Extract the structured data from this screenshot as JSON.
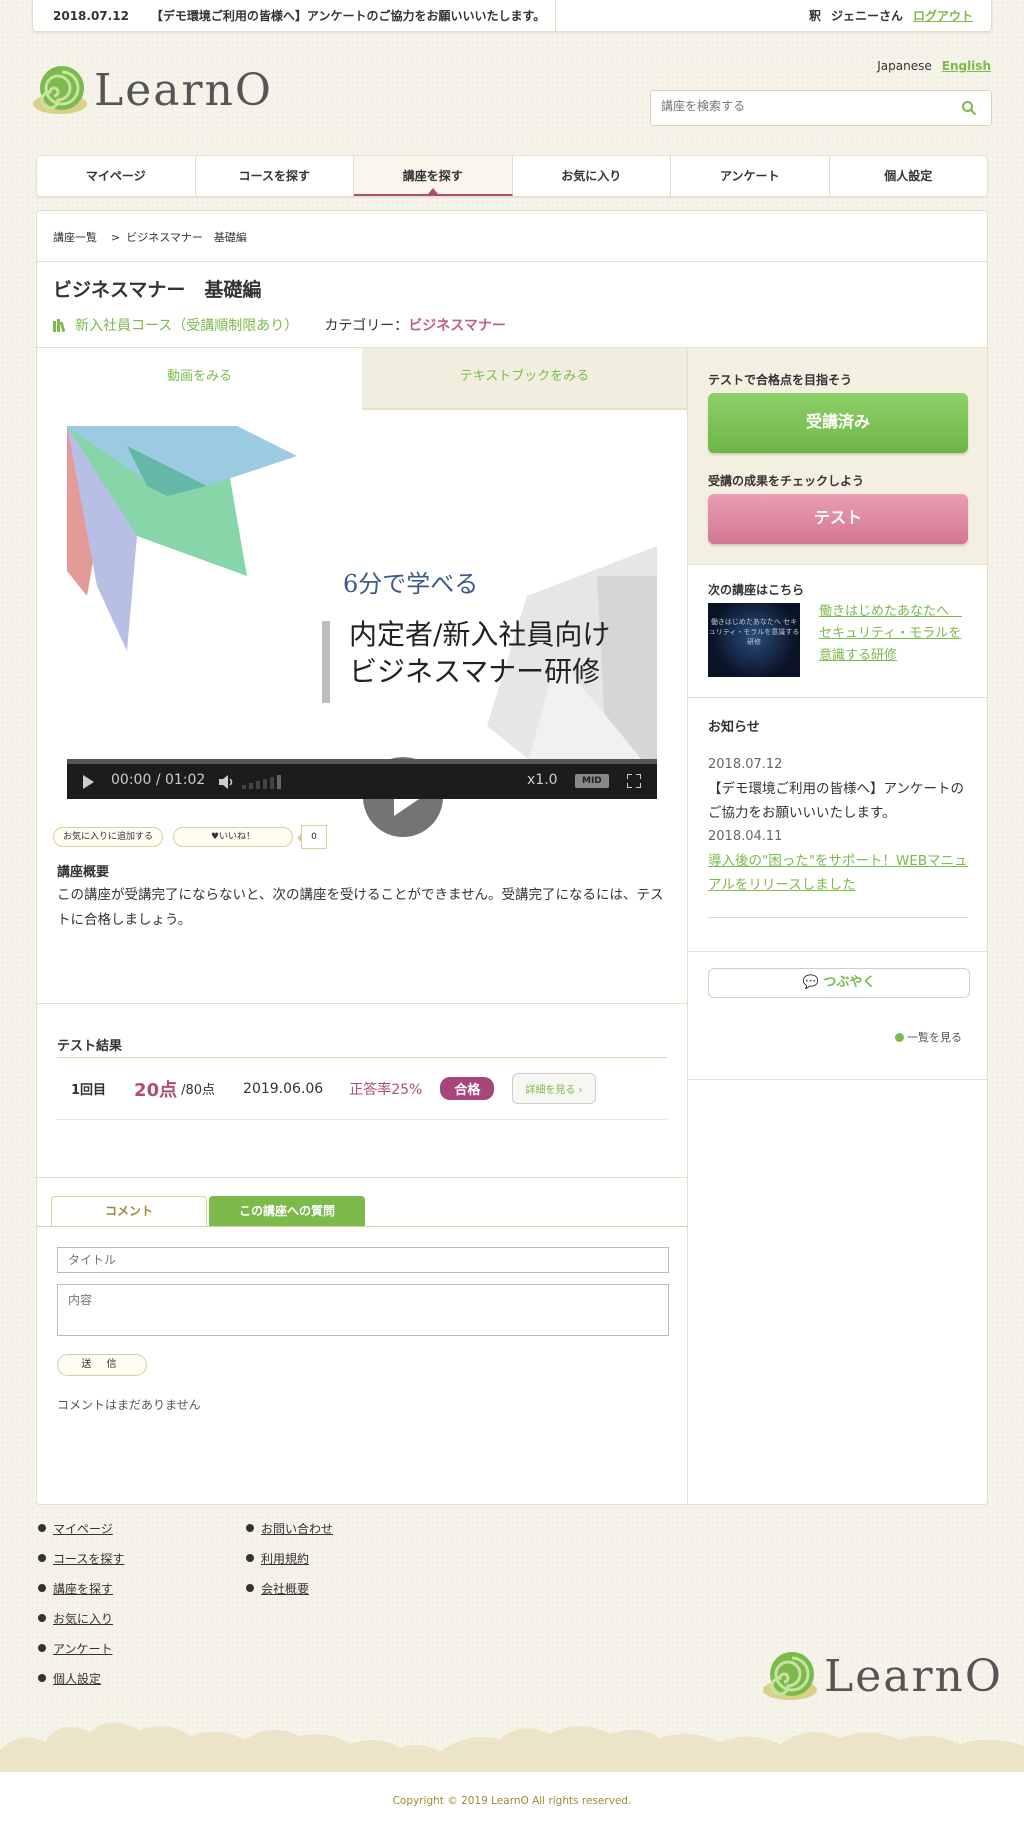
{
  "topbar": {
    "news_date": "2018.07.12",
    "news_text": "【デモ環境ご利用の皆様へ】アンケートのご協力をお願いいいたします。",
    "user_prefix": "釈",
    "user_name": "ジェニーさん",
    "logout": "ログアウト"
  },
  "header": {
    "logo_text": "LearnO",
    "lang_ja": "Japanese",
    "lang_en": "English",
    "search_placeholder": "講座を検索する"
  },
  "nav": {
    "items": [
      "マイページ",
      "コースを探す",
      "講座を探す",
      "お気に入り",
      "アンケート",
      "個人設定"
    ],
    "active": "講座を探す"
  },
  "breadcrumb": {
    "root": "講座一覧",
    "sep": ">",
    "current": "ビジネスマナー　基礎編"
  },
  "lecture": {
    "title": "ビジネスマナー　基礎編",
    "course": "新入社員コース（受講順制限あり）",
    "category_label": "カテゴリー：",
    "category": "ビジネスマナー"
  },
  "media_tabs": {
    "video": "動画をみる",
    "textbook": "テキストブックをみる"
  },
  "video": {
    "title_line1": "6分で学べる",
    "title_line2": "内定者/新入社員向け",
    "title_line3": "ビジネスマナー研修",
    "current_time": "00:00",
    "separator": "/",
    "duration": "01:02",
    "speed": "x1.0",
    "quality": "MID"
  },
  "actions": {
    "favorite": "お気に入りに追加する",
    "like": "♥いいね！",
    "like_count": "0"
  },
  "overview": {
    "heading": "講座概要",
    "text": "この講座が受講完了にならないと、次の講座を受けることができません。受講完了になるには、テストに合格しましょう。"
  },
  "test_results": {
    "heading": "テスト結果",
    "rows": [
      {
        "attempt": "1回目",
        "score": "20点",
        "max": "/80点",
        "date": "2019.06.06",
        "rate": "正答率25%",
        "status": "合格",
        "detail": "詳細を見る ›"
      }
    ]
  },
  "comments": {
    "tab_comment": "コメント",
    "tab_question": "この講座への質問",
    "title_placeholder": "タイトル",
    "body_placeholder": "内容",
    "send": "送 信",
    "empty": "コメントはまだありません"
  },
  "sidebar": {
    "goal_heading": "テストで合格点を目指そう",
    "done_button": "受講済み",
    "check_heading": "受講の成果をチェックしよう",
    "test_button": "テスト",
    "next_heading": "次の講座はこちら",
    "next_thumb_text": "働きはじめたあなたへ セキュリティ・モラルを意識する研修",
    "next_link": "働きはじめたあなたへ　セキュリティ・モラルを意識する研修",
    "news_heading": "お知らせ",
    "news": [
      {
        "date": "2018.07.12",
        "text": "【デモ環境ご利用の皆様へ】アンケートのご協力をお願いいいたします。",
        "link": false
      },
      {
        "date": "2018.04.11",
        "text": "導入後の\"困った\"をサポート！WEBマニュアルをリリースしました",
        "link": true
      }
    ],
    "tweet": "つぶやく",
    "see_all": "一覧を見る"
  },
  "footer": {
    "col1": [
      "マイページ",
      "コースを探す",
      "講座を探す",
      "お気に入り",
      "アンケート",
      "個人設定"
    ],
    "col2": [
      "お問い合わせ",
      "利用規約",
      "会社概要"
    ],
    "logo_text": "LearnO",
    "copyright": "Copyright © 2019 LearnO All rights reserved."
  },
  "colors": {
    "accent_green": "#7bba4b",
    "accent_pink": "#b04b73",
    "background": "#f6f3ea"
  }
}
